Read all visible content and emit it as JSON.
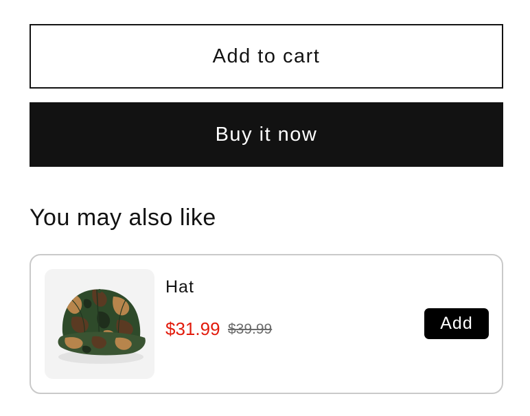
{
  "product_form": {
    "add_to_cart_label": "Add to cart",
    "buy_now_label": "Buy it now"
  },
  "recommendations": {
    "heading": "You may also like",
    "items": [
      {
        "title": "Hat",
        "sale_price": "$31.99",
        "compare_price": "$39.99",
        "add_label": "Add",
        "image_icon": "camo-cap-image"
      }
    ]
  },
  "colors": {
    "primary": "#121212",
    "sale_price": "#e21b0c",
    "compare_price": "#6b6b6b",
    "card_border": "#c9c9c9",
    "thumb_background": "#f3f3f3"
  }
}
